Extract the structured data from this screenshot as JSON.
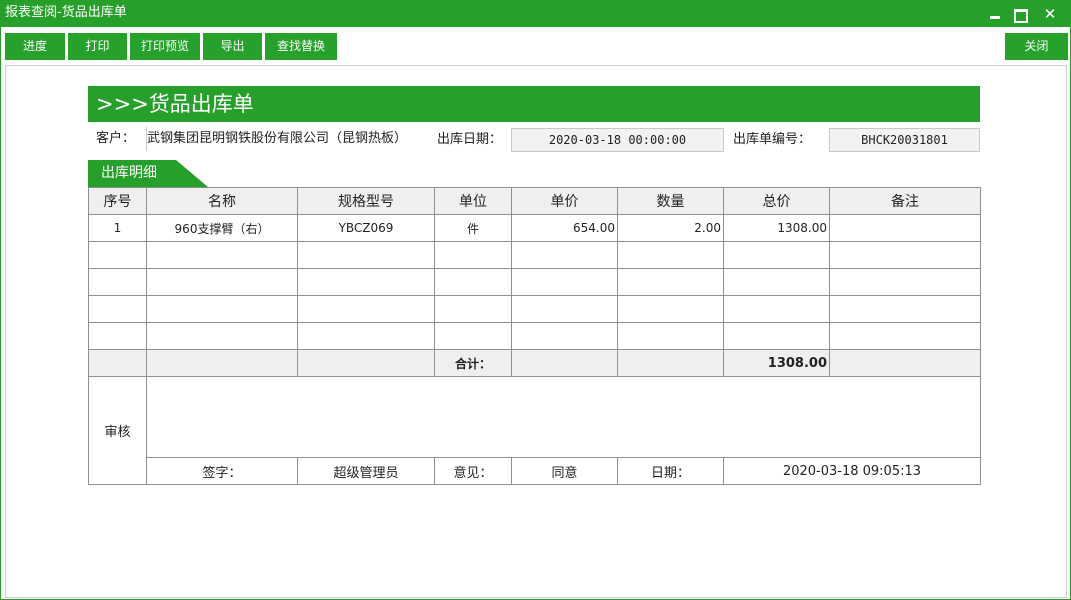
{
  "window": {
    "title": "报表查阅-货品出库单",
    "minimize_glyph": "",
    "close_glyph": "✕"
  },
  "toolbar": {
    "buttons": [
      "进度",
      "打印",
      "打印预览",
      "导出",
      "查找替换"
    ],
    "close_label": "关闭"
  },
  "report": {
    "title": ">>>货品出库单",
    "customer_label": "客户：",
    "customer_value": "武钢集团昆明钢铁股份有限公司（昆钢热板）",
    "date_label": "出库日期：",
    "date_value": "2020-03-18 00:00:00",
    "number_label": "出库单编号：",
    "number_value": "BHCK20031801",
    "section_tab": "出库明细"
  },
  "table": {
    "headers": [
      "序号",
      "名称",
      "规格型号",
      "单位",
      "单价",
      "数量",
      "总价",
      "备注"
    ],
    "rows": [
      [
        "1",
        "960支撑臂（右）",
        "YBCZ069",
        "件",
        "654.00",
        "2.00",
        "1308.00",
        ""
      ],
      [
        "",
        "",
        "",
        "",
        "",
        "",
        "",
        ""
      ],
      [
        "",
        "",
        "",
        "",
        "",
        "",
        "",
        ""
      ],
      [
        "",
        "",
        "",
        "",
        "",
        "",
        "",
        ""
      ],
      [
        "",
        "",
        "",
        "",
        "",
        "",
        "",
        ""
      ]
    ],
    "total_label": "合计：",
    "total_value": "1308.00"
  },
  "approval": {
    "label": "审核",
    "sign_label": "签字：",
    "sign_value": "超级管理员",
    "opinion_label": "意见：",
    "opinion_value": "同意",
    "date_label": "日期：",
    "date_value": "2020-03-18 09:05:13"
  },
  "colors": {
    "accent": "#27a02b",
    "header_bg": "#efefef",
    "grid_border": "#8f8f8f"
  }
}
